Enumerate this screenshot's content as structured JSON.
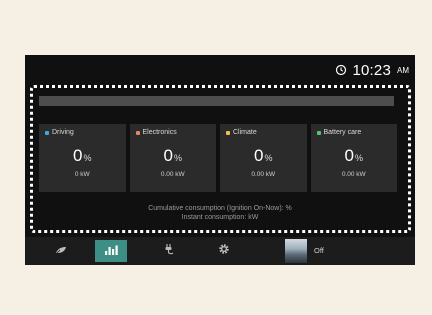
{
  "status": {
    "time": "10:23",
    "ampm": "AM",
    "status_icon": "power-clock-icon"
  },
  "categories": [
    {
      "label": "Driving",
      "value": "0",
      "unit": "%",
      "power": "0 kW",
      "color": "#3ba8e0"
    },
    {
      "label": "Electronics",
      "value": "0",
      "unit": "%",
      "power": "0.00 kW",
      "color": "#e8826a"
    },
    {
      "label": "Climate",
      "value": "0",
      "unit": "%",
      "power": "0.00 kW",
      "color": "#e8c24a"
    },
    {
      "label": "Battery care",
      "value": "0",
      "unit": "%",
      "power": "0.00 kW",
      "color": "#58c46a"
    }
  ],
  "consumption": {
    "cumulative": "Cumulative consumption (Ignition On-Now): %",
    "instant": "Instant consumption: kW"
  },
  "bottom": {
    "off_label": "Off",
    "items": [
      "leaf-icon",
      "bar-chart-icon",
      "charging-plug-icon",
      "gear-icon",
      "scenery-thumbnail"
    ]
  },
  "colors": {
    "accent": "#3d8f86",
    "screen_bg": "#101010",
    "card_bg": "#2b2b2b"
  }
}
